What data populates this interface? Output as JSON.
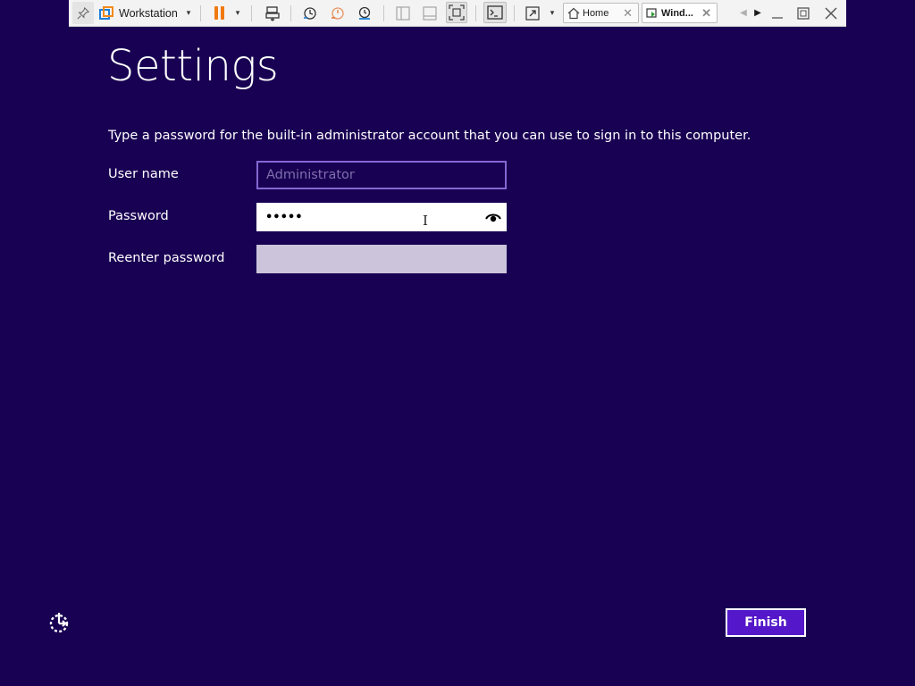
{
  "toolbar": {
    "app_name": "Workstation",
    "dropdown_glyph": "▾",
    "tabs": [
      {
        "label": "Home",
        "close": "✕"
      },
      {
        "label": "Wind...",
        "close": "✕"
      }
    ],
    "nav_prev": "◀",
    "nav_next": "▶",
    "icons": [
      "pin-icon",
      "vmware-logo-icon",
      "pause-icon",
      "send-keys-icon",
      "snapshot-icon",
      "revert-snapshot-icon",
      "snapshot-manager-icon",
      "library-icon",
      "thumbnail-bar-icon",
      "full-screen-icon",
      "console-view-icon",
      "stretch-icon",
      "minimize-icon",
      "restore-icon",
      "close-icon"
    ],
    "accent_pause": "#f07a12"
  },
  "setup": {
    "title": "Settings",
    "instructions": "Type a password for the built-in administrator account that you can use to sign in to this computer.",
    "fields": {
      "username": {
        "label": "User name",
        "value": "Administrator"
      },
      "password": {
        "label": "Password",
        "value": "•••••"
      },
      "reenter": {
        "label": "Reenter password",
        "value": ""
      }
    },
    "text_cursor": "I",
    "finish_label": "Finish"
  },
  "colors": {
    "background": "#180052",
    "finish_button": "#5417c9",
    "username_border": "#8567d2",
    "reenter_fill": "#cbc4da"
  }
}
